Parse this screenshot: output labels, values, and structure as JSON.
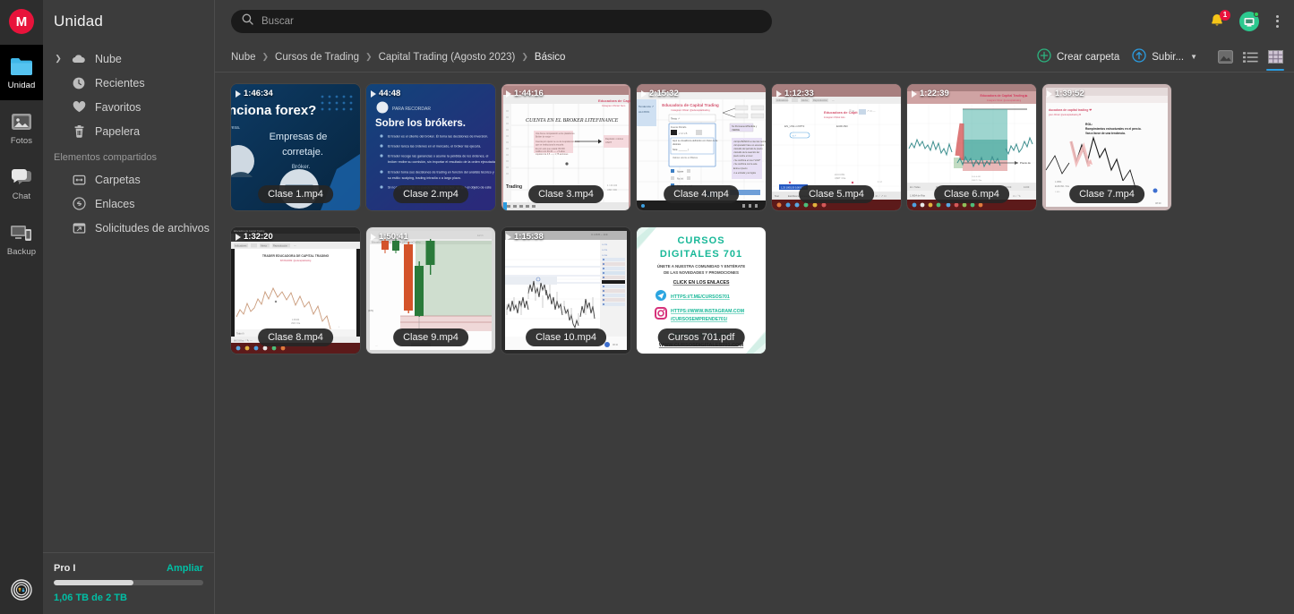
{
  "rail": {
    "logo_letter": "M",
    "items": [
      {
        "label": "Unidad",
        "icon": "folder-icon",
        "active": true
      },
      {
        "label": "Fotos",
        "icon": "photos-icon",
        "active": false
      },
      {
        "label": "Chat",
        "icon": "chat-icon",
        "active": false
      },
      {
        "label": "Backup",
        "icon": "backup-icon",
        "active": false
      }
    ],
    "status_icon": "transfers-icon"
  },
  "sidebar": {
    "title": "Unidad",
    "items": [
      {
        "label": "Nube",
        "icon": "cloud-icon",
        "expandable": true
      },
      {
        "label": "Recientes",
        "icon": "clock-icon",
        "expandable": false
      },
      {
        "label": "Favoritos",
        "icon": "heart-icon",
        "expandable": false
      },
      {
        "label": "Papelera",
        "icon": "trash-icon",
        "expandable": false
      }
    ],
    "shared_section_label": "Elementos compartidos",
    "shared_items": [
      {
        "label": "Carpetas",
        "icon": "shared-folders-icon"
      },
      {
        "label": "Enlaces",
        "icon": "link-icon"
      },
      {
        "label": "Solicitudes de archivos",
        "icon": "file-request-icon"
      }
    ],
    "storage": {
      "plan": "Pro I",
      "upgrade_label": "Ampliar",
      "used_text": "1,06 TB de 2 TB",
      "percent": 53,
      "accent_color": "#00bfa5"
    }
  },
  "topbar": {
    "search_placeholder": "Buscar",
    "search_value": "",
    "search_icon": "search-icon",
    "notifications_icon": "bell-icon",
    "notifications_count": "1",
    "avatar_icon": "avatar-icon",
    "menu_icon": "kebab-menu-icon"
  },
  "breadcrumb": {
    "separator": "›",
    "items": [
      "Nube",
      "Cursos de Trading",
      "Capital Trading (Agosto 2023)",
      "Básico"
    ]
  },
  "actions": {
    "create_folder_label": "Crear carpeta",
    "create_folder_icon": "plus-circle-icon",
    "upload_label": "Subir...",
    "upload_icon": "upload-circle-icon",
    "upload_caret_icon": "chevron-down-icon",
    "view_gallery_icon": "gallery-view-icon",
    "view_list_icon": "list-view-icon",
    "view_grid_icon": "grid-view-icon",
    "active_view": "grid",
    "accent_color": "#2b9ce0"
  },
  "files": [
    {
      "name": "Clase 1.mp4",
      "duration": "1:46:34",
      "type": "video",
      "thumb": "forex-slide"
    },
    {
      "name": "Clase 2.mp4",
      "duration": "44:48",
      "type": "video",
      "thumb": "brokers-slide"
    },
    {
      "name": "Clase 3.mp4",
      "duration": "1:44:16",
      "type": "video",
      "thumb": "whiteboard-broker"
    },
    {
      "name": "Clase 4.mp4",
      "duration": "2:15:32",
      "type": "video",
      "thumb": "whiteboard-dialog"
    },
    {
      "name": "Clase 5.mp4",
      "duration": "1:12:33",
      "type": "video",
      "thumb": "whiteboard-blank"
    },
    {
      "name": "Clase 6.mp4",
      "duration": "1:22:39",
      "type": "video",
      "thumb": "chart-zones"
    },
    {
      "name": "Clase 7.mp4",
      "duration": "1:39:52",
      "type": "video",
      "thumb": "chart-zigzag"
    },
    {
      "name": "Clase 8.mp4",
      "duration": "1:32:20",
      "type": "video",
      "thumb": "chart-line"
    },
    {
      "name": "Clase 9.mp4",
      "duration": "1:50:41",
      "type": "video",
      "thumb": "chart-candles"
    },
    {
      "name": "Clase 10.mp4",
      "duration": "1:15:38",
      "type": "video",
      "thumb": "chart-dark"
    },
    {
      "name": "Cursos 701.pdf",
      "duration": "",
      "type": "pdf",
      "thumb": "cursos-701-flyer"
    }
  ],
  "pdf_flyer": {
    "title_line1": "CURSOS",
    "title_line2": "DIGITALES 701",
    "sub_line1": "ÚNETE A NUESTRA COMUNIDAD Y ENTÉRATE",
    "sub_line2": "DE LAS NOVEDADES Y PROMOCIONES",
    "cta": "CLICK EN LOS ENLACES",
    "link1": "HTTPS://T.ME/CURSOS701",
    "link2a": "HTTPS://WWW.INSTAGRAM.COM",
    "link2b": "/CURSOSEMPRENDE701/",
    "footer": "WWW.CURSOSDIGITALES701.COM",
    "accent": "#18b898"
  },
  "slide1": {
    "heading": "nciona forex?",
    "line1": "Empresas de",
    "line2": "corretaje.",
    "line3": "Bróker."
  },
  "slide2": {
    "kicker": "PARA RECORDAR",
    "heading": "Sobre los brókers."
  },
  "slide3": {
    "heading": "CUENTA EN EL BROKER LITEFINANCE"
  },
  "slide8": {
    "heading": "TRADER EDUCADORA DE CAPITAL TRADING"
  }
}
